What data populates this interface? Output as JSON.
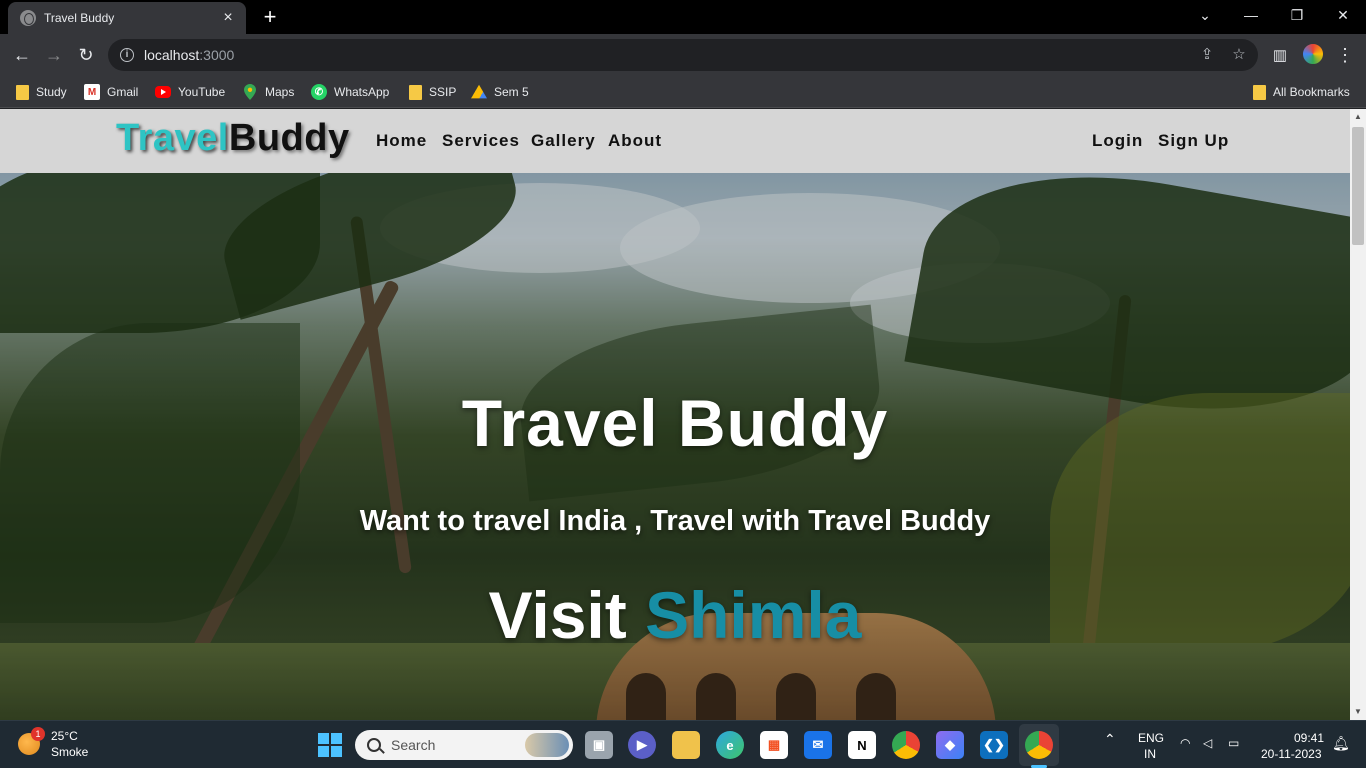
{
  "browser": {
    "tab_title": "Travel Buddy",
    "tab_close": "×",
    "new_tab": "+",
    "url_host": "localhost",
    "url_port": ":3000",
    "bookmarks": [
      {
        "label": "Study",
        "icon": "folder-icon"
      },
      {
        "label": "Gmail",
        "icon": "gmail-icon"
      },
      {
        "label": "YouTube",
        "icon": "youtube-icon"
      },
      {
        "label": "Maps",
        "icon": "maps-icon"
      },
      {
        "label": "WhatsApp",
        "icon": "whatsapp-icon"
      },
      {
        "label": "SSIP",
        "icon": "folder-icon"
      },
      {
        "label": "Sem 5",
        "icon": "google-drive-icon"
      }
    ],
    "all_bookmarks": "All Bookmarks"
  },
  "site": {
    "logo_part1": "Travel",
    "logo_part2": "Buddy",
    "nav": [
      "Home",
      "Services",
      "Gallery",
      "About"
    ],
    "auth": [
      "Login",
      "Sign Up"
    ],
    "hero": {
      "title": "Travel Buddy",
      "subtitle": "Want to travel India , Travel with Travel Buddy",
      "visit_prefix": "Visit",
      "visit_city": "Shimla"
    },
    "colors": {
      "logo_accent": "#2ec4c4",
      "city_accent": "#178ea5",
      "navbar_bg": "#d6d6d6"
    }
  },
  "taskbar": {
    "weather_temp": "25°C",
    "weather_desc": "Smoke",
    "weather_badge": "1",
    "search_placeholder": "Search",
    "lang_top": "ENG",
    "lang_bottom": "IN",
    "time": "09:41",
    "date": "20-11-2023"
  }
}
